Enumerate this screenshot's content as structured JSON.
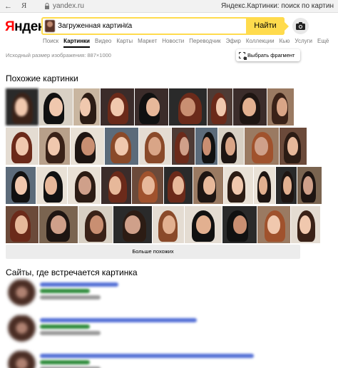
{
  "browser": {
    "back_glyph": "←",
    "favicon_glyph": "Я",
    "url": "yandex.ru",
    "tab_title": "Яндекс.Картинки: поиск по картин"
  },
  "header": {
    "logo_y": "Я",
    "logo_rest": "ндекс",
    "query": "Загруженная картинка",
    "clear_glyph": "✕",
    "search_button": "Найти",
    "camera_icon": "camera-icon"
  },
  "services": [
    "Поиск",
    "Картинки",
    "Видео",
    "Карты",
    "Маркет",
    "Новости",
    "Переводчик",
    "Эфир",
    "Коллекции",
    "Кью",
    "Услуги",
    "Ещё"
  ],
  "active_service_index": 1,
  "image_info": {
    "original_size": "Исходный размер изображения: 887×1000",
    "fragment_button": "Выбрать фрагмент"
  },
  "similar": {
    "title": "Похожие картинки",
    "more_button": "Больше похожих"
  },
  "sites": {
    "title": "Сайты, где встречается картинка"
  },
  "colors": {
    "accent_yellow": "#ffdb4d",
    "logo_red": "#ff0000",
    "link_blue": "#5470d6",
    "url_green": "#2e8b3b"
  }
}
